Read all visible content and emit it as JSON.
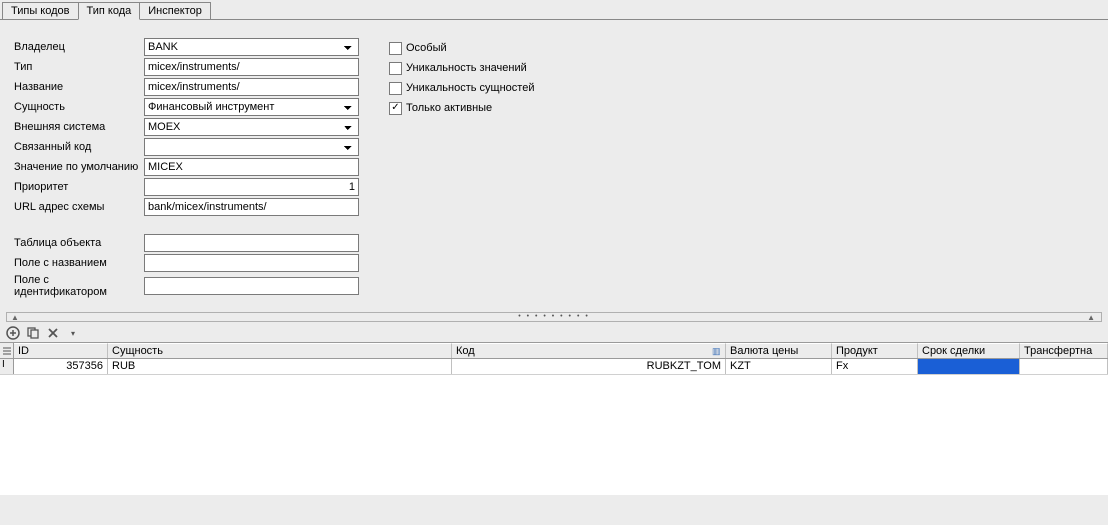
{
  "tabs": {
    "t0": "Типы кодов",
    "t1": "Тип кода",
    "t2": "Инспектор",
    "active": 1
  },
  "form": {
    "owner_label": "Владелец",
    "owner_value": "BANK",
    "type_label": "Тип",
    "type_value": "micex/instruments/",
    "name_label": "Название",
    "name_value": "micex/instruments/",
    "entity_label": "Сущность",
    "entity_value": "Финансовый инструмент",
    "extsys_label": "Внешняя система",
    "extsys_value": "MOEX",
    "linked_label": "Связанный код",
    "linked_value": "",
    "default_label": "Значение по умолчанию",
    "default_value": "MICEX",
    "priority_label": "Приоритет",
    "priority_value": "1",
    "url_label": "URL адрес схемы",
    "url_value": "bank/micex/instruments/",
    "objtable_label": "Таблица объекта",
    "objtable_value": "",
    "namefield_label": "Поле с названием",
    "namefield_value": "",
    "idfield_label": "Поле с идентификатором",
    "idfield_value": ""
  },
  "flags": {
    "special": "Особый",
    "uniq_values": "Уникальность значений",
    "uniq_entities": "Уникальность сущностей",
    "active_only": "Только активные"
  },
  "grid": {
    "headers": {
      "id": "ID",
      "entity": "Сущность",
      "code": "Код",
      "price_currency": "Валюта цены",
      "product": "Продукт",
      "deal_term": "Срок сделки",
      "transfer": "Трансфертна"
    },
    "row": {
      "id": "357356",
      "entity": "RUB",
      "code": "RUBKZT_TOM",
      "price_currency": "KZT",
      "product": "Fx",
      "deal_term": "",
      "transfer": ""
    }
  }
}
